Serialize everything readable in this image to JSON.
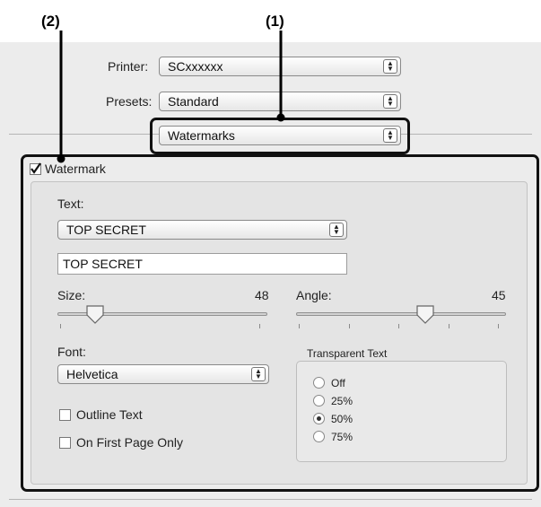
{
  "callouts": {
    "one": "(1)",
    "two": "(2)"
  },
  "printer": {
    "label": "Printer:",
    "value": "SCxxxxxx"
  },
  "presets": {
    "label": "Presets:",
    "value": "Standard"
  },
  "panel_menu": {
    "value": "Watermarks"
  },
  "watermark": {
    "checkbox_label": "Watermark",
    "checked": true,
    "text_label": "Text:",
    "text_preset": "TOP SECRET",
    "text_value": "TOP SECRET",
    "size_label": "Size:",
    "size_value": "48",
    "angle_label": "Angle:",
    "angle_value": "45",
    "font_label": "Font:",
    "font_value": "Helvetica",
    "outline_label": "Outline Text",
    "outline_checked": false,
    "first_page_label": "On First Page Only",
    "first_page_checked": false,
    "transparency": {
      "title": "Transparent Text",
      "options": [
        "Off",
        "25%",
        "50%",
        "75%"
      ],
      "selected": "50%"
    }
  }
}
